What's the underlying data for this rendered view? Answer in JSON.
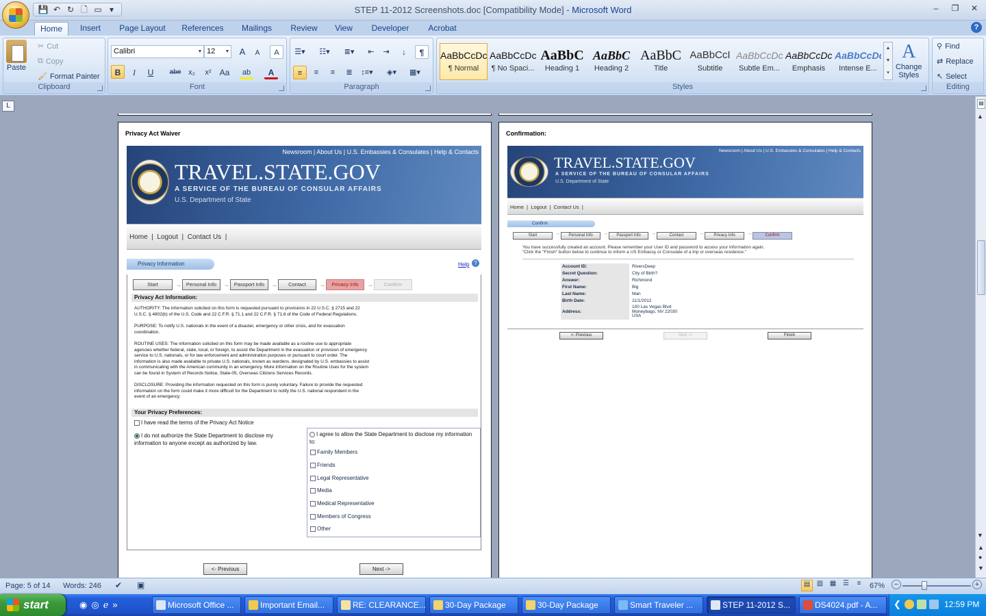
{
  "window": {
    "title": "STEP 11-2012 Screenshots.doc [Compatibility Mode]",
    "separator": " - ",
    "app_name": "Microsoft Word",
    "minimize": "–",
    "maximize": "❐",
    "close": "✕"
  },
  "qat": {
    "save": "💾",
    "undo": "↶",
    "redo": "↻",
    "print_preview": "🗋",
    "open": "▭",
    "more": "▾"
  },
  "tabs": [
    "Home",
    "Insert",
    "Page Layout",
    "References",
    "Mailings",
    "Review",
    "View",
    "Developer",
    "Acrobat"
  ],
  "help_icon": "?",
  "clipboard": {
    "paste": "Paste",
    "cut": "Cut",
    "copy": "Copy",
    "format_painter": "Format Painter",
    "label": "Clipboard"
  },
  "font": {
    "family": "Calibri",
    "size": "12",
    "grow": "A",
    "shrink": "A",
    "clear": "A",
    "bold": "B",
    "italic": "I",
    "underline": "U",
    "strike": "abe",
    "subscript": "x₂",
    "superscript": "x²",
    "case": "Aa",
    "highlight": "ab",
    "color": "A",
    "label": "Font"
  },
  "paragraph": {
    "label": "Paragraph",
    "show_marks": "¶",
    "sort": "↓"
  },
  "styles": {
    "label": "Styles",
    "items": [
      {
        "preview": "AaBbCcDc",
        "name": "¶ Normal"
      },
      {
        "preview": "AaBbCcDc",
        "name": "¶ No Spaci..."
      },
      {
        "preview": "AaBbC",
        "name": "Heading 1"
      },
      {
        "preview": "AaBbC",
        "name": "Heading 2"
      },
      {
        "preview": "AaBbC",
        "name": "Title"
      },
      {
        "preview": "AaBbCcI",
        "name": "Subtitle"
      },
      {
        "preview": "AaBbCcDc",
        "name": "Subtle Em..."
      },
      {
        "preview": "AaBbCcDc",
        "name": "Emphasis"
      },
      {
        "preview": "AaBbCcDc",
        "name": "Intense E..."
      }
    ],
    "change_styles_line1": "Change",
    "change_styles_line2": "Styles"
  },
  "editing": {
    "find": "Find",
    "replace": "Replace",
    "select": "Select",
    "label": "Editing"
  },
  "ruler_tab": "L",
  "page_left": {
    "caption": "Privacy Act Waiver",
    "site": {
      "links": "Newsroom | About Us | U.S. Embassies & Consulates | Help & Contacts",
      "brand": "TRAVEL.STATE.GOV",
      "subtitle": "A SERVICE OF THE BUREAU OF CONSULAR AFFAIRS",
      "dept": "U.S. Department of State",
      "nav": [
        "Home",
        "Logout",
        "Contact Us"
      ]
    },
    "section_pill": "Privacy Information",
    "help": "Help",
    "steps": [
      "Start",
      "Personal Info",
      "Passport Info",
      "Contact",
      "Privacy Info",
      "Confirm"
    ],
    "privacy_header": "Privacy Act Information:",
    "paragraphs": [
      "AUTHORITY: The information solicited on this form is requested pursuant to provisions in 22 U.S.C. § 2715 and 22\nU.S.C. § 4802(b) of the U.S. Code and 22 C.F.R. § 71.1 and 22 C.F.R. § 71.6 of the Code of Federal Regulations.",
      "PURPOSE: To notify U.S. nationals in the event of a disaster, emergency or other crisis, and for evacuation\ncoordination.",
      "ROUTINE USES: The information solicited on this form may be made available as a routine use to appropriate\nagencies whether federal, state, local, or foreign, to assist the Department in the evacuation or provision of emergency\nservice to U.S. nationals, or for law enforcement and administration purposes or pursuant to court order. The\ninformation is also made available to private U.S. nationals, known as wardens, designated by U.S. embassies to assist\nin communicating with the American community in an emergency. More information on the Routine Uses for the system\ncan be found in System of Records Notice, State-05, Overseas Citizens Services Records.",
      "DISCLOSURE: Providing the information requested on this form is purely voluntary. Failure to provide the requested\ninformation on the form could make it more difficult for the Department to notify the U.S. national respondent in the\nevent of an emergency."
    ],
    "prefs_header": "Your Privacy Preferences:",
    "read_terms": "I have read the terms of the Privacy Act Notice",
    "not_authorize": "I do not authorize the State Department to disclose my information to anyone except as authorized by law.",
    "agree": "I agree to allow the State Department to disclose my information to:",
    "recipients": [
      "Family Members",
      "Friends",
      "Legal Representative",
      "Media",
      "Medical Representative",
      "Members of Congress",
      "Other"
    ],
    "prev_btn": "<- Previous",
    "next_btn": "Next ->"
  },
  "page_right": {
    "caption": "Confirmation:",
    "site": {
      "links": "Newsroom | About Us | U.S. Embassies & Consulates | Help & Contacts",
      "brand": "TRAVEL.STATE.GOV",
      "subtitle": "A SERVICE OF THE BUREAU OF CONSULAR AFFAIRS",
      "dept": "U.S. Department of State",
      "nav": [
        "Home",
        "Logout",
        "Contact Us"
      ]
    },
    "section_pill": "Confirm",
    "steps": [
      "Start",
      "Personal Info",
      "Passport Info",
      "Contact",
      "Privacy Info",
      "Confirm"
    ],
    "message": "You have successfully created an account. Please remember your User ID and password to access your information again.\n\"Click the \"Finish\" button below to continue to inform a US Embassy or Consulate of a trip or overseas residence.\"",
    "fields": [
      {
        "label": "Account ID:",
        "value": "RiversDeep"
      },
      {
        "label": "Secret Question:",
        "value": "City of Birth?"
      },
      {
        "label": "Answer:",
        "value": "Richmond"
      },
      {
        "label": "First Name:",
        "value": "Big"
      },
      {
        "label": "Last Name:",
        "value": "Man"
      },
      {
        "label": "Birth Date:",
        "value": "11/1/2012"
      },
      {
        "label": "Address:",
        "value": "100 Las Vegas Blvd\nMoneybags, NV 22030\nUSA"
      }
    ],
    "prev_btn": "<- Previous",
    "next_btn": "Next ->",
    "finish_btn": "Finish"
  },
  "status": {
    "page": "Page: 5 of 14",
    "words": "Words: 246",
    "zoom": "67%",
    "zoom_minus": "−",
    "zoom_plus": "+"
  },
  "taskbar": {
    "start": "start",
    "items": [
      "Microsoft Office ...",
      "Important Email...",
      "RE: CLEARANCE...",
      "30-Day Package",
      "30-Day Package",
      "Smart Traveler ...",
      "STEP 11-2012 S...",
      "DS4024.pdf - A..."
    ],
    "clock": "12:59 PM"
  }
}
